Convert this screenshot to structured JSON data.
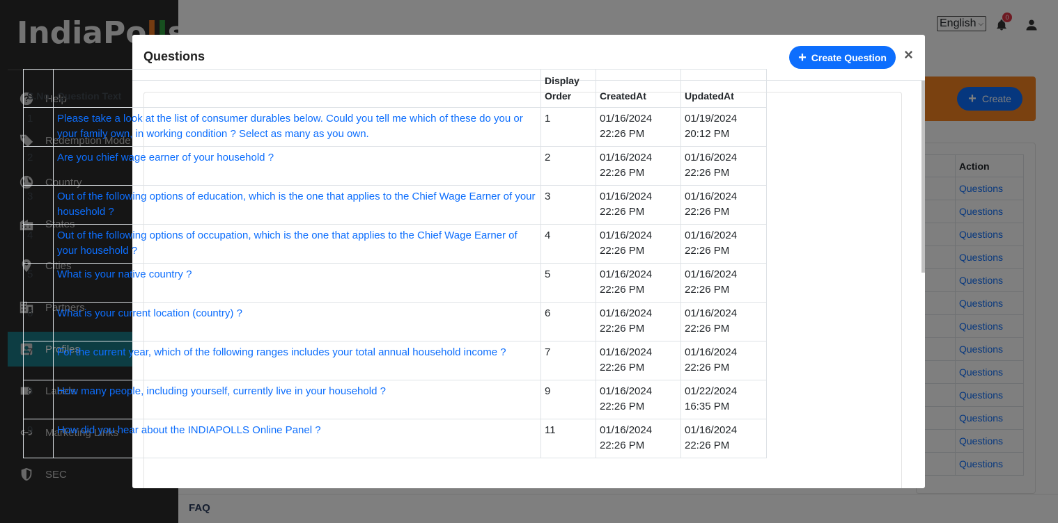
{
  "brand": {
    "logo_main": "IndiaPo",
    "logo_tail1": "l",
    "logo_tail2": "l",
    "logo_tail3": "s"
  },
  "sidebar": {
    "items": [
      {
        "label": "Help",
        "icon": "help-circle-icon"
      },
      {
        "label": "Redemption Mode",
        "icon": "tag-icon"
      },
      {
        "label": "Country",
        "icon": "globe-icon"
      },
      {
        "label": "States",
        "icon": "buildings-icon"
      },
      {
        "label": "Cities",
        "icon": "map-pin-icon"
      },
      {
        "label": "Partners",
        "icon": "office-building-icon"
      },
      {
        "label": "Profiles",
        "icon": "profile-card-icon",
        "active": true
      },
      {
        "label": "Labels",
        "icon": "label-icon"
      },
      {
        "label": "Marketing Links",
        "icon": "link-icon"
      },
      {
        "label": "SEC",
        "icon": "shield-icon"
      }
    ]
  },
  "topbar": {
    "language": "English",
    "notifications_count": "0"
  },
  "background": {
    "create_label": "Create",
    "action_header": "Action",
    "action_link": "Questions",
    "rows": [
      "Questions",
      "Questions",
      "Questions",
      "Questions",
      "Questions",
      "Questions",
      "Questions",
      "Questions",
      "Questions",
      "Questions",
      "Questions",
      "Questions",
      "Questions"
    ],
    "footer_link": "FAQ"
  },
  "modal": {
    "title": "Questions",
    "create_button": "Create Question",
    "close_label": "×",
    "columns": {
      "sno": "S.No",
      "text": "Question Text",
      "order_line1": "Display",
      "order_line2": "Order",
      "created": "CreatedAt",
      "updated": "UpdatedAt"
    },
    "rows": [
      {
        "sno": "1",
        "text": "Please take a look at the list of consumer durables below. Could you tell me which of these do you or your family own, in working condition ? Select as many as you own.",
        "order": "1",
        "created_date": "01/16/2024",
        "created_time": "22:26 PM",
        "updated_date": "01/19/2024",
        "updated_time": "20:12 PM"
      },
      {
        "sno": "2",
        "text": "Are you chief wage earner of your household ?",
        "order": "2",
        "created_date": "01/16/2024",
        "created_time": "22:26 PM",
        "updated_date": "01/16/2024",
        "updated_time": "22:26 PM"
      },
      {
        "sno": "3",
        "text": "Out of the following options of education, which is the one that applies to the Chief Wage Earner of your household ?",
        "order": "3",
        "created_date": "01/16/2024",
        "created_time": "22:26 PM",
        "updated_date": "01/16/2024",
        "updated_time": "22:26 PM"
      },
      {
        "sno": "4",
        "text": "Out of the following options of occupation, which is the one that applies to the Chief Wage Earner of your household ?",
        "order": "4",
        "created_date": "01/16/2024",
        "created_time": "22:26 PM",
        "updated_date": "01/16/2024",
        "updated_time": "22:26 PM"
      },
      {
        "sno": "5",
        "text": "What is your native country ?",
        "order": "5",
        "created_date": "01/16/2024",
        "created_time": "22:26 PM",
        "updated_date": "01/16/2024",
        "updated_time": "22:26 PM"
      },
      {
        "sno": "6",
        "text": "What is your current location (country) ?",
        "order": "6",
        "created_date": "01/16/2024",
        "created_time": "22:26 PM",
        "updated_date": "01/16/2024",
        "updated_time": "22:26 PM"
      },
      {
        "sno": "7",
        "text": "For the current year, which of the following ranges includes your total annual household income ?",
        "order": "7",
        "created_date": "01/16/2024",
        "created_time": "22:26 PM",
        "updated_date": "01/16/2024",
        "updated_time": "22:26 PM"
      },
      {
        "sno": "8",
        "text": "How many people, including yourself, currently live in your household ?",
        "order": "9",
        "created_date": "01/16/2024",
        "created_time": "22:26 PM",
        "updated_date": "01/22/2024",
        "updated_time": "16:35 PM"
      },
      {
        "sno": "9",
        "text": "How did you hear about the INDIAPOLLS Online Panel ?",
        "order": "11",
        "created_date": "01/16/2024",
        "created_time": "22:26 PM",
        "updated_date": "01/16/2024",
        "updated_time": "22:26 PM"
      }
    ]
  },
  "colors": {
    "sidebar_bg": "#2b2b2b",
    "active_item": "#1a7a86",
    "primary": "#0d6efd",
    "accent_orange": "#f58220"
  }
}
